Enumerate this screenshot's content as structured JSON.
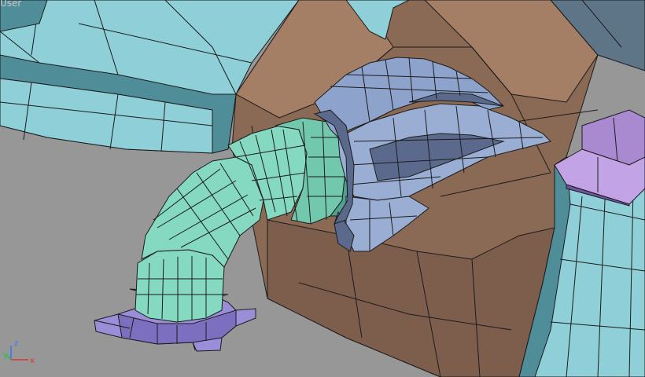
{
  "viewport": {
    "label": "User"
  },
  "axis_gizmo": {
    "x_label": "x",
    "y_label": "y",
    "z_label": "z",
    "colors": {
      "x": "#e0302a",
      "y": "#27c24a",
      "z": "#3a72ff"
    }
  },
  "scene": {
    "colors": {
      "ground": "#979797",
      "wall_teal": "#8fcfd8",
      "wall_teal_shadow": "#4f8e98",
      "pocket_brown": "#8b6a55",
      "pocket_brown_light": "#a57e66",
      "pipe_green": "#84d9c0",
      "pipe_green_dark": "#4fa28d",
      "claw_blue": "#9aaed4",
      "claw_blue_dark": "#5b6a8c",
      "base_purple": "#9b8ed8",
      "cap_purple": "#a98ad0",
      "wire": "#1b1b1b"
    },
    "objects": [
      "ground-plane",
      "left-teal-block",
      "top-teal-block",
      "brown-pocket",
      "right-teal-wall",
      "purple-cap",
      "green-pipe",
      "purple-base",
      "blue-claw"
    ]
  }
}
